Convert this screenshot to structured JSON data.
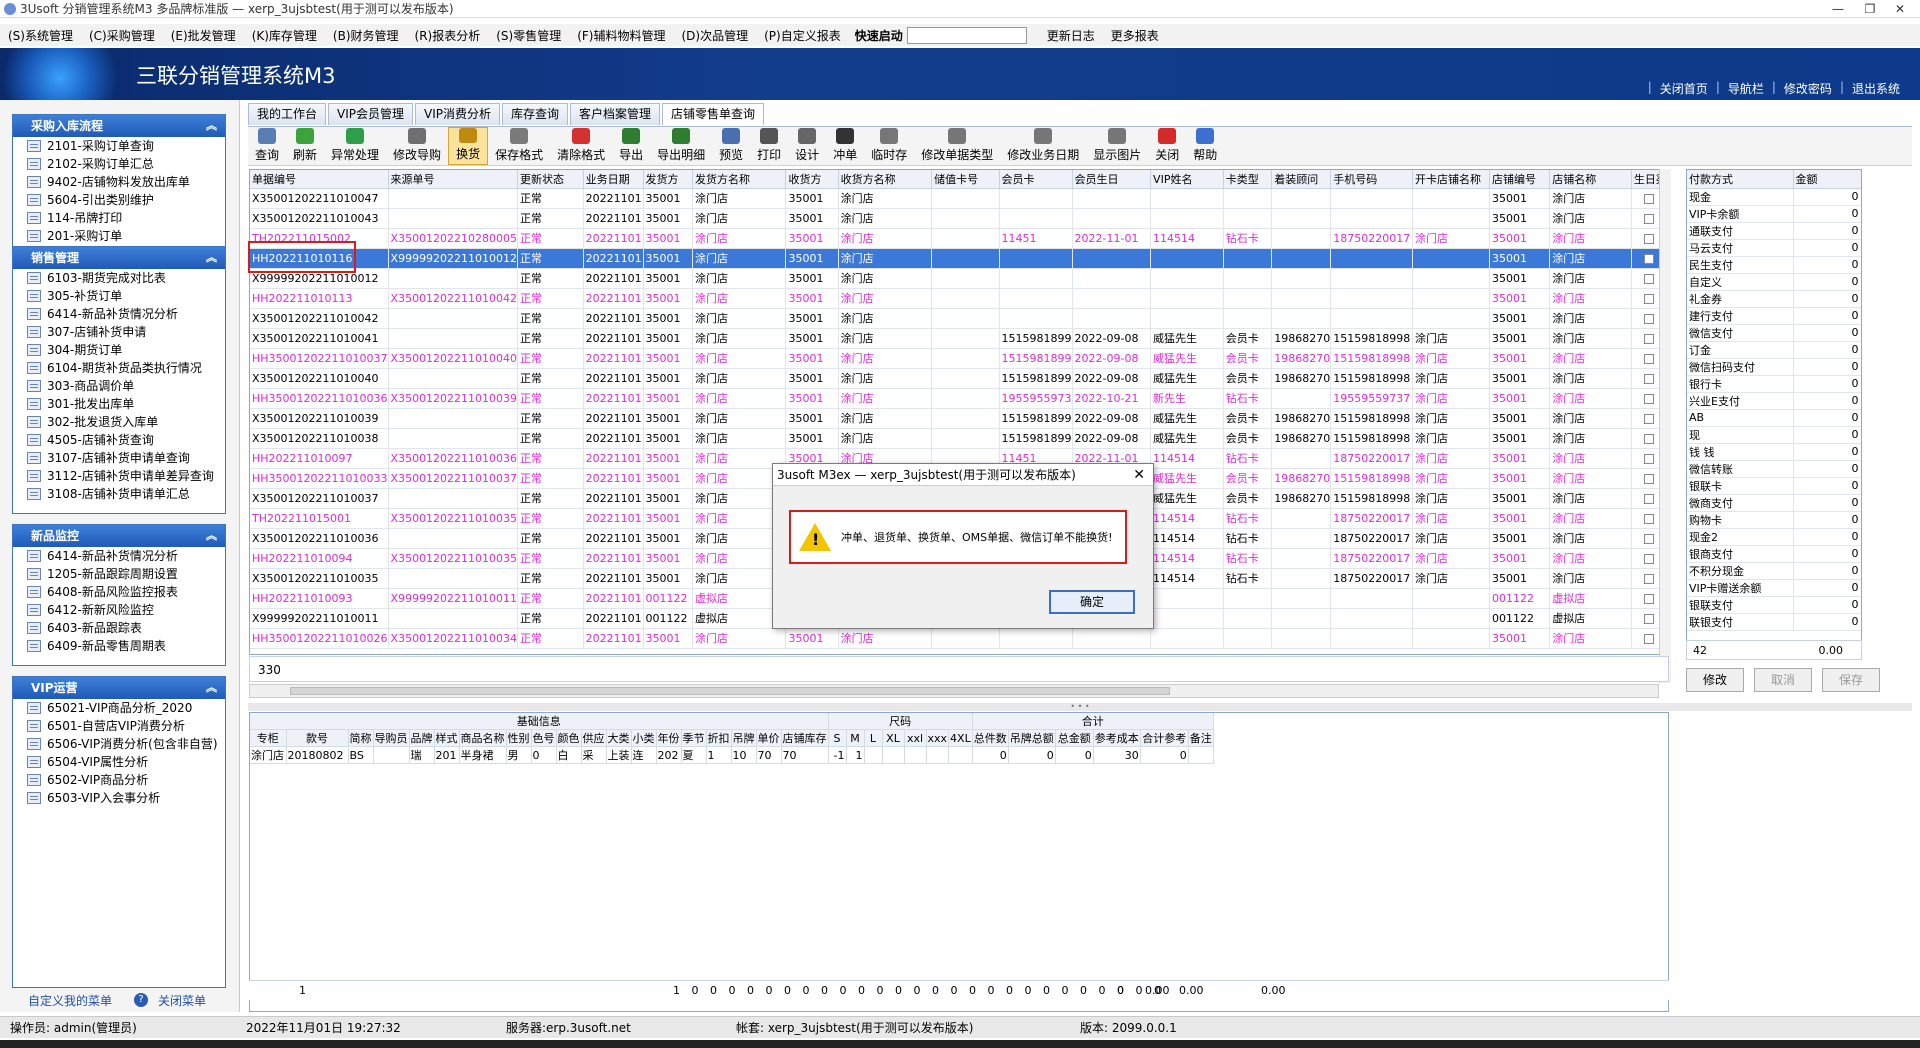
{
  "window": {
    "title": "3Usoft 分销管理系统M3 多品牌标准版 — xerp_3ujsbtest(用于测可以发布版本)",
    "controls": [
      "—",
      "❐",
      "✕"
    ]
  },
  "menu": {
    "items": [
      "(S)系统管理",
      "(C)采购管理",
      "(E)批发管理",
      "(K)库存管理",
      "(B)财务管理",
      "(R)报表分析",
      "(S)零售管理",
      "(F)辅料物料管理",
      "(D)次品管理",
      "(P)自定义报表"
    ],
    "quick_start": "快速启动",
    "update_log": "更新日志",
    "more_reports": "更多报表"
  },
  "banner": {
    "title": "三联分销管理系统M3",
    "links": [
      "关闭首页",
      "导航栏",
      "修改密码",
      "退出系统"
    ]
  },
  "sidebar": {
    "panels": [
      {
        "title": "采购入库流程",
        "items": [
          "2101-采购订单查询",
          "2102-采购订单汇总",
          "9402-店铺物料发放出库单",
          "5604-引出类别维护",
          "114-吊牌打印",
          "201-采购订单"
        ]
      },
      {
        "title": "销售管理",
        "items": [
          "6103-期货完成对比表",
          "305-补货订单",
          "6414-新品补货情况分析",
          "307-店铺补货申请",
          "304-期货订单",
          "6104-期货补货品类执行情况",
          "303-商品调价单",
          "301-批发出库单",
          "302-批发退货入库单",
          "4505-店铺补货查询",
          "3107-店铺补货申请单查询",
          "3112-店铺补货申请单差异查询",
          "3108-店铺补货申请单汇总"
        ]
      },
      {
        "title": "新品监控",
        "items": [
          "6414-新品补货情况分析",
          "1205-新品跟踪周期设置",
          "6408-新品风险监控报表",
          "6412-新新风险监控",
          "6403-新品跟踪表",
          "6409-新品零售周期表"
        ]
      },
      {
        "title": "VIP运营",
        "items": [
          "65021-VIP商品分析_2020",
          "6501-自营店VIP消费分析",
          "6506-VIP消费分析(包含非自营)",
          "6504-VIP属性分析",
          "6502-VIP商品分析",
          "6503-VIP入会事分析"
        ]
      }
    ],
    "custom_menu": "自定义我的菜单",
    "close_menu": "关闭菜单"
  },
  "tabs": [
    "我的工作台",
    "VIP会员管理",
    "VIP消费分析",
    "库存查询",
    "客户档案管理",
    "店铺零售单查询"
  ],
  "toolbar": [
    {
      "label": "查询",
      "icon": "search-icon",
      "color": "#5b7db5"
    },
    {
      "label": "刷新",
      "icon": "refresh-icon",
      "color": "#3ba33b"
    },
    {
      "label": "异常处理",
      "icon": "exception-icon",
      "color": "#2e9e4b"
    },
    {
      "label": "修改导购",
      "icon": "edit-guide-icon",
      "color": "#6f6f6f"
    },
    {
      "label": "换货",
      "icon": "exchange-icon",
      "color": "#c08a10"
    },
    {
      "label": "保存格式",
      "icon": "save-format-icon",
      "color": "#7b7b7b"
    },
    {
      "label": "清除格式",
      "icon": "clear-format-icon",
      "color": "#d43131"
    },
    {
      "label": "导出",
      "icon": "export-icon",
      "color": "#2f7d2f"
    },
    {
      "label": "导出明细",
      "icon": "export-detail-icon",
      "color": "#2f7d2f"
    },
    {
      "label": "预览",
      "icon": "preview-icon",
      "color": "#4a6fb0"
    },
    {
      "label": "打印",
      "icon": "print-icon",
      "color": "#555555"
    },
    {
      "label": "设计",
      "icon": "design-icon",
      "color": "#666666"
    },
    {
      "label": "冲单",
      "icon": "reverse-icon",
      "color": "#333333"
    },
    {
      "label": "临时存",
      "icon": "temp-save-icon",
      "color": "#777777"
    },
    {
      "label": "修改单据类型",
      "icon": "doc-type-icon",
      "color": "#777777"
    },
    {
      "label": "修改业务日期",
      "icon": "date-icon",
      "color": "#777777"
    },
    {
      "label": "显示图片",
      "icon": "image-icon",
      "color": "#777777"
    },
    {
      "label": "关闭",
      "icon": "close-icon",
      "color": "#d42a2a"
    },
    {
      "label": "帮助",
      "icon": "help-icon",
      "color": "#3b6fd0"
    }
  ],
  "grid": {
    "columns": [
      "单据编号",
      "来源单号",
      "更新状态",
      "业务日期",
      "发货方",
      "发货方名称",
      "收货方",
      "收货方名称",
      "储值卡号",
      "会员卡",
      "会员生日",
      "VIP姓名",
      "卡类型",
      "着装顾问",
      "手机号码",
      "开卡店铺名称",
      "店铺编号",
      "店铺名称",
      "生日渠"
    ],
    "rows": [
      {
        "style": "normal",
        "cells": [
          "X35001202211010047",
          "",
          "正常",
          "20221101",
          "35001",
          "涂门店",
          "35001",
          "涂门店",
          "",
          "",
          "",
          "",
          "",
          "",
          "",
          "",
          "35001",
          "涂门店",
          ""
        ]
      },
      {
        "style": "normal",
        "cells": [
          "X35001202211010043",
          "",
          "正常",
          "20221101",
          "35001",
          "涂门店",
          "35001",
          "涂门店",
          "",
          "",
          "",
          "",
          "",
          "",
          "",
          "",
          "35001",
          "涂门店",
          ""
        ]
      },
      {
        "style": "pink",
        "cells": [
          "TH202211015002",
          "X35001202210280005",
          "正常",
          "20221101",
          "35001",
          "涂门店",
          "35001",
          "涂门店",
          "",
          "11451",
          "2022-11-01",
          "114514",
          "钻石卡",
          "",
          "18750220017",
          "涂门店",
          "35001",
          "涂门店",
          ""
        ]
      },
      {
        "style": "sel",
        "cells": [
          "HH202211010116",
          "X99999202211010012",
          "正常",
          "20221101",
          "35001",
          "涂门店",
          "35001",
          "涂门店",
          "",
          "",
          "",
          "",
          "",
          "",
          "",
          "",
          "35001",
          "涂门店",
          ""
        ]
      },
      {
        "style": "normal",
        "cells": [
          "X99999202211010012",
          "",
          "正常",
          "20221101",
          "35001",
          "涂门店",
          "35001",
          "涂门店",
          "",
          "",
          "",
          "",
          "",
          "",
          "",
          "",
          "35001",
          "涂门店",
          ""
        ]
      },
      {
        "style": "pink",
        "cells": [
          "HH202211010113",
          "X35001202211010042",
          "正常",
          "20221101",
          "35001",
          "涂门店",
          "35001",
          "涂门店",
          "",
          "",
          "",
          "",
          "",
          "",
          "",
          "",
          "35001",
          "涂门店",
          ""
        ]
      },
      {
        "style": "normal",
        "cells": [
          "X35001202211010042",
          "",
          "正常",
          "20221101",
          "35001",
          "涂门店",
          "35001",
          "涂门店",
          "",
          "",
          "",
          "",
          "",
          "",
          "",
          "",
          "35001",
          "涂门店",
          ""
        ]
      },
      {
        "style": "normal",
        "cells": [
          "X35001202211010041",
          "",
          "正常",
          "20221101",
          "35001",
          "涂门店",
          "35001",
          "涂门店",
          "",
          "1515981899",
          "2022-09-08",
          "威猛先生",
          "会员卡",
          "19868270",
          "15159818998",
          "涂门店",
          "35001",
          "涂门店",
          ""
        ]
      },
      {
        "style": "pink",
        "cells": [
          "HH35001202211010037",
          "X35001202211010040",
          "正常",
          "20221101",
          "35001",
          "涂门店",
          "35001",
          "涂门店",
          "",
          "1515981899",
          "2022-09-08",
          "威猛先生",
          "会员卡",
          "19868270",
          "15159818998",
          "涂门店",
          "35001",
          "涂门店",
          ""
        ]
      },
      {
        "style": "normal",
        "cells": [
          "X35001202211010040",
          "",
          "正常",
          "20221101",
          "35001",
          "涂门店",
          "35001",
          "涂门店",
          "",
          "1515981899",
          "2022-09-08",
          "威猛先生",
          "会员卡",
          "19868270",
          "15159818998",
          "涂门店",
          "35001",
          "涂门店",
          ""
        ]
      },
      {
        "style": "pink",
        "cells": [
          "HH35001202211010036",
          "X35001202211010039",
          "正常",
          "20221101",
          "35001",
          "涂门店",
          "35001",
          "涂门店",
          "",
          "1955955973",
          "2022-10-21",
          "新先生",
          "钻石卡",
          "",
          "19559559737",
          "涂门店",
          "35001",
          "涂门店",
          ""
        ]
      },
      {
        "style": "normal",
        "cells": [
          "X35001202211010039",
          "",
          "正常",
          "20221101",
          "35001",
          "涂门店",
          "35001",
          "涂门店",
          "",
          "1515981899",
          "2022-09-08",
          "威猛先生",
          "会员卡",
          "19868270",
          "15159818998",
          "涂门店",
          "35001",
          "涂门店",
          ""
        ]
      },
      {
        "style": "normal",
        "cells": [
          "X35001202211010038",
          "",
          "正常",
          "20221101",
          "35001",
          "涂门店",
          "35001",
          "涂门店",
          "",
          "1515981899",
          "2022-09-08",
          "威猛先生",
          "会员卡",
          "19868270",
          "15159818998",
          "涂门店",
          "35001",
          "涂门店",
          ""
        ]
      },
      {
        "style": "pink",
        "cells": [
          "HH202211010097",
          "X35001202211010036",
          "正常",
          "20221101",
          "35001",
          "涂门店",
          "35001",
          "涂门店",
          "",
          "11451",
          "2022-11-01",
          "114514",
          "钻石卡",
          "",
          "18750220017",
          "涂门店",
          "35001",
          "涂门店",
          ""
        ]
      },
      {
        "style": "pink",
        "cells": [
          "HH35001202211010033",
          "X35001202211010037",
          "正常",
          "20221101",
          "35001",
          "涂门店",
          "35001",
          "涂门店",
          "",
          "",
          "",
          "威猛先生",
          "会员卡",
          "19868270",
          "15159818998",
          "涂门店",
          "35001",
          "涂门店",
          ""
        ]
      },
      {
        "style": "normal",
        "cells": [
          "X35001202211010037",
          "",
          "正常",
          "20221101",
          "35001",
          "涂门店",
          "35001",
          "涂门店",
          "",
          "",
          "",
          "威猛先生",
          "会员卡",
          "19868270",
          "15159818998",
          "涂门店",
          "35001",
          "涂门店",
          ""
        ]
      },
      {
        "style": "pink",
        "cells": [
          "TH202211015001",
          "X35001202211010035",
          "正常",
          "20221101",
          "35001",
          "涂门店",
          "",
          "",
          "",
          "",
          "",
          "114514",
          "钻石卡",
          "",
          "18750220017",
          "涂门店",
          "35001",
          "涂门店",
          ""
        ]
      },
      {
        "style": "normal",
        "cells": [
          "X35001202211010036",
          "",
          "正常",
          "20221101",
          "35001",
          "涂门店",
          "",
          "",
          "",
          "",
          "",
          "114514",
          "钻石卡",
          "",
          "18750220017",
          "涂门店",
          "35001",
          "涂门店",
          ""
        ]
      },
      {
        "style": "pink",
        "cells": [
          "HH202211010094",
          "X35001202211010035",
          "正常",
          "20221101",
          "35001",
          "涂门店",
          "",
          "",
          "",
          "",
          "",
          "114514",
          "钻石卡",
          "",
          "18750220017",
          "涂门店",
          "35001",
          "涂门店",
          ""
        ]
      },
      {
        "style": "normal",
        "cells": [
          "X35001202211010035",
          "",
          "正常",
          "20221101",
          "35001",
          "涂门店",
          "",
          "",
          "",
          "",
          "",
          "114514",
          "钻石卡",
          "",
          "18750220017",
          "涂门店",
          "35001",
          "涂门店",
          ""
        ]
      },
      {
        "style": "pink",
        "cells": [
          "HH202211010093",
          "X99999202211010011",
          "正常",
          "20221101",
          "001122",
          "虚拟店",
          "",
          "",
          "",
          "",
          "",
          "",
          "",
          "",
          "",
          "",
          "001122",
          "虚拟店",
          ""
        ]
      },
      {
        "style": "normal",
        "cells": [
          "X99999202211010011",
          "",
          "正常",
          "20221101",
          "001122",
          "虚拟店",
          "",
          "",
          "",
          "",
          "",
          "",
          "",
          "",
          "",
          "",
          "001122",
          "虚拟店",
          ""
        ]
      },
      {
        "style": "pink",
        "cells": [
          "HH35001202211010026",
          "X35001202211010034",
          "正常",
          "20221101",
          "35001",
          "涂门店",
          "35001",
          "涂门店",
          "",
          "",
          "",
          "",
          "",
          "",
          "",
          "",
          "35001",
          "涂门店",
          ""
        ]
      }
    ],
    "footer_count": "330"
  },
  "payment": {
    "columns": [
      "付款方式",
      "金额"
    ],
    "rows": [
      [
        "现金",
        "0"
      ],
      [
        "VIP卡余额",
        "0"
      ],
      [
        "通联支付",
        "0"
      ],
      [
        "马云支付",
        "0"
      ],
      [
        "民生支付",
        "0"
      ],
      [
        "自定义",
        "0"
      ],
      [
        "礼金券",
        "0"
      ],
      [
        "建行支付",
        "0"
      ],
      [
        "微信支付",
        "0"
      ],
      [
        "订金",
        "0"
      ],
      [
        "微信扫码支付",
        "0"
      ],
      [
        "银行卡",
        "0"
      ],
      [
        "兴业E支付",
        "0"
      ],
      [
        "AB",
        "0"
      ],
      [
        "现",
        "0"
      ],
      [
        "钱 钱",
        "0"
      ],
      [
        "微信转账",
        "0"
      ],
      [
        "银联卡",
        "0"
      ],
      [
        "微商支付",
        "0"
      ],
      [
        "购物卡",
        "0"
      ],
      [
        "现金2",
        "0"
      ],
      [
        "银商支付",
        "0"
      ],
      [
        "不积分现金",
        "0"
      ],
      [
        "VIP卡赠送余额",
        "0"
      ],
      [
        "银联支付",
        "0"
      ],
      [
        "联银支付",
        "0"
      ]
    ],
    "footer_count": "42",
    "footer_total": "0.00",
    "buttons": [
      "修改",
      "取消",
      "保存"
    ]
  },
  "detail": {
    "group_headers": [
      "基础信息",
      "尺码",
      "合计"
    ],
    "columns": [
      "专柜",
      "款号",
      "简称",
      "导购员",
      "品牌",
      "样式",
      "商品名称",
      "性别",
      "色号",
      "颜色",
      "供应",
      "大类",
      "小类",
      "年份",
      "季节",
      "折扣",
      "吊牌",
      "单价",
      "店铺库存",
      "S",
      "M",
      "L",
      "XL",
      "xxl",
      "xxx",
      "4XL",
      "总件数",
      "吊牌总额",
      "总金额",
      "参考成本",
      "合计参考",
      "备注"
    ],
    "row": [
      "涂门店",
      "20180802",
      "BS",
      "",
      "瑞",
      "201",
      "半身裙",
      "男",
      "0",
      "白",
      "采",
      "上装",
      "连",
      "202",
      "夏",
      "1",
      "10",
      "70",
      "70",
      "-1",
      "1",
      "",
      "",
      "",
      "",
      "",
      "0",
      "0",
      "0",
      "30",
      "0",
      ""
    ],
    "sum_count": "1",
    "sum_values": [
      "1",
      "0",
      "0",
      "0",
      "0",
      "0",
      "0",
      "0",
      "0",
      "0",
      "0",
      "0",
      "0",
      "0",
      "0",
      "0",
      "0",
      "0",
      "0",
      "0",
      "0",
      "0",
      "0",
      "0",
      "0",
      "0",
      "0"
    ],
    "sum_tail": [
      "0",
      "0.00",
      "0.00",
      "0.00"
    ]
  },
  "status": {
    "operator": "操作员: admin(管理员)",
    "datetime": "2022年11月01日 19:27:32",
    "server": "服务器:erp.3usoft.net",
    "account": "帐套: xerp_3ujsbtest(用于测可以发布版本)",
    "version": "版本: 2099.0.0.1"
  },
  "dialog": {
    "title": "3usoft M3ex — xerp_3ujsbtest(用于测可以发布版本)",
    "message": "冲单、退货单、换货单、OMS单据、微信订单不能换货!",
    "ok": "确定"
  }
}
